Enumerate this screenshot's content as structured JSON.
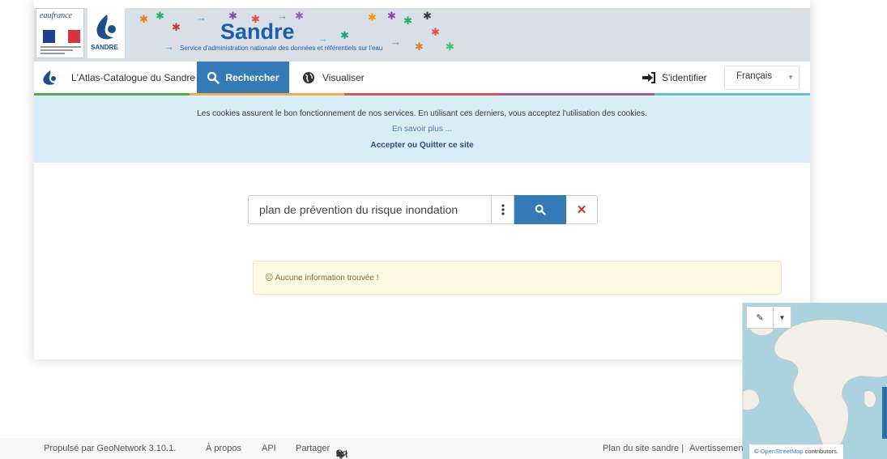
{
  "banner": {
    "eaufrance_logo": "eaufrance",
    "sandre_logo_text": "SANDRE",
    "title": "Sandre",
    "subtitle": "Service d'administration nationale des données et référentiels sur l'eau"
  },
  "nav": {
    "brand_label": "L'Atlas-Catalogue du Sandre",
    "search_label": "Rechercher",
    "visualize_label": "Visualiser",
    "login_label": "S'identifier",
    "language": "Français"
  },
  "cookie": {
    "message": "Les cookies assurent le bon fonctionnement de nos services. En utilisant ces derniers, vous acceptez l'utilisation des cookies.",
    "learn_more": "En savoir plus ...",
    "accept": "Accepter",
    "or": "ou",
    "quit": "Quitter ce site"
  },
  "search": {
    "query": "plan de prévention du risque inondation"
  },
  "alert": {
    "message": "Aucune information trouvée !"
  },
  "map": {
    "attribution_prefix": "©",
    "attribution_link": "OpenStreetMap",
    "attribution_suffix": "contributors."
  },
  "footer": {
    "powered_by": "Propulsé par GeoNetwork 3.10.1.",
    "about": "À propos",
    "api": "API",
    "share": "Partager",
    "sitemap": "Plan du site sandre |",
    "warnings": "Avertissemen"
  },
  "colors": {
    "primary": "#337ab7",
    "cookie_bg": "#d9edf7",
    "alert_bg": "#fcf8e3",
    "map_water": "#aad3df",
    "nav_stripe": [
      "#4cae4c",
      "#f0ad4e",
      "#d9534f",
      "#9b59b6",
      "#5bc0de"
    ]
  }
}
